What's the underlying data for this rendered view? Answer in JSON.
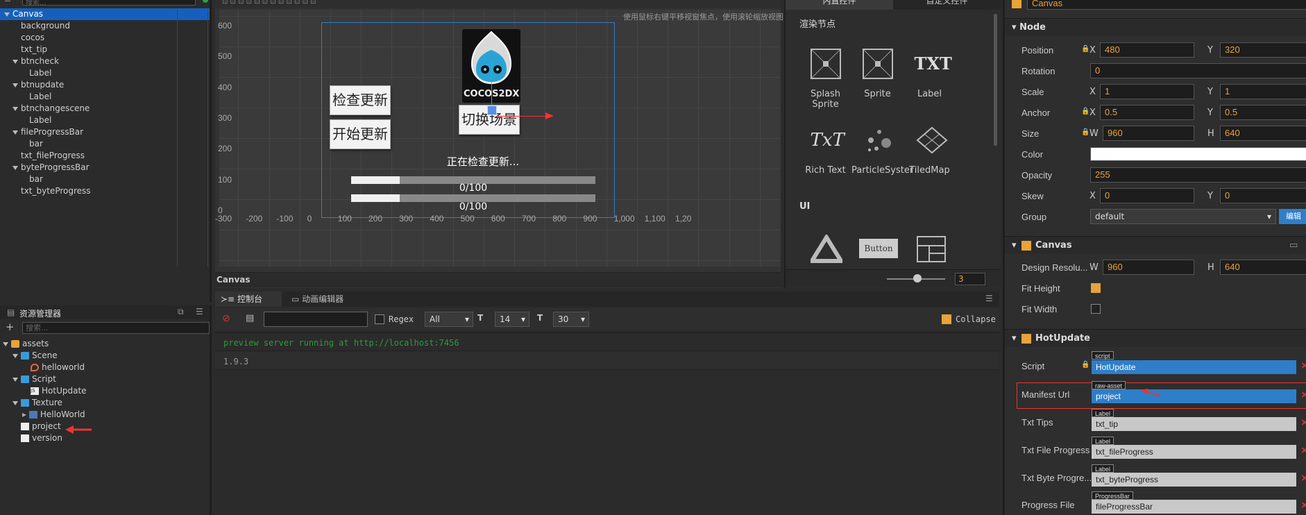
{
  "hierarchy": {
    "search_placeholder": "搜索...",
    "items": [
      {
        "label": "Canvas",
        "expanded": true
      },
      {
        "label": "background"
      },
      {
        "label": "cocos"
      },
      {
        "label": "txt_tip"
      },
      {
        "label": "btncheck",
        "expanded": true
      },
      {
        "label": "Label"
      },
      {
        "label": "btnupdate",
        "expanded": true
      },
      {
        "label": "Label"
      },
      {
        "label": "btnchangescene",
        "expanded": true
      },
      {
        "label": "Label"
      },
      {
        "label": "fileProgressBar",
        "expanded": true
      },
      {
        "label": "bar"
      },
      {
        "label": "txt_fileProgress"
      },
      {
        "label": "byteProgressBar",
        "expanded": true
      },
      {
        "label": "bar"
      },
      {
        "label": "txt_byteProgress"
      }
    ]
  },
  "scene": {
    "hint": "使用鼠标右键平移视窗焦点，使用滚轮缩放视图",
    "footer_label": "Canvas",
    "y_ticks": [
      "600",
      "500",
      "400",
      "300",
      "200",
      "100",
      "0"
    ],
    "x_ticks": [
      "-300",
      "-200",
      "-100",
      "0",
      "100",
      "200",
      "300",
      "400",
      "500",
      "600",
      "700",
      "800",
      "900",
      "1,000",
      "1,100",
      "1,20"
    ],
    "btn_check": "检查更新",
    "btn_update": "开始更新",
    "btn_change": "切换场景",
    "status": "正在检查更新...",
    "file_progress_text": "0/100",
    "byte_progress_text": "0/100",
    "file_progress": 0.2,
    "byte_progress": 0.2,
    "logo_text": "COCOS2DX"
  },
  "library": {
    "tab_builtin": "内置控件",
    "tab_custom": "自定义控件",
    "section_render": "渲染节点",
    "section_ui": "UI",
    "items": [
      "Splash Sprite",
      "Sprite",
      "Label",
      "Rich Text",
      "ParticleSyster",
      "TiledMap"
    ],
    "label_glyph": "TXT",
    "richtext_glyph": "TxT",
    "button_glyph": "Button",
    "zoom_value": "3"
  },
  "assets": {
    "title": "资源管理器",
    "search_placeholder": "搜索...",
    "items": [
      {
        "label": "assets"
      },
      {
        "label": "Scene"
      },
      {
        "label": "helloworld"
      },
      {
        "label": "Script"
      },
      {
        "label": "HotUpdate"
      },
      {
        "label": "Texture"
      },
      {
        "label": "HelloWorld"
      },
      {
        "label": "project"
      },
      {
        "label": "version"
      }
    ]
  },
  "console": {
    "tab_console": "控制台",
    "tab_anim": "动画编辑器",
    "regex_label": "Regex",
    "level_value": "All",
    "font_size": "14",
    "line_height": "30",
    "collapse_label": "Collapse",
    "lines": [
      "preview server running at http://localhost:7456",
      "1.9.3"
    ],
    "line_colors": [
      "#2e9a3a",
      "#999999"
    ]
  },
  "inspector": {
    "node_name": "Canvas",
    "node_section": "Node",
    "position": {
      "label": "Position",
      "x": "480",
      "y": "320"
    },
    "rotation": {
      "label": "Rotation",
      "value": "0"
    },
    "scale": {
      "label": "Scale",
      "x": "1",
      "y": "1"
    },
    "anchor": {
      "label": "Anchor",
      "x": "0.5",
      "y": "0.5"
    },
    "size": {
      "label": "Size",
      "w": "960",
      "h": "640"
    },
    "color": {
      "label": "Color",
      "value": "#ffffff"
    },
    "opacity": {
      "label": "Opacity",
      "value": "255"
    },
    "skew": {
      "label": "Skew",
      "x": "0",
      "y": "0"
    },
    "group": {
      "label": "Group",
      "value": "default",
      "edit": "编辑"
    },
    "canvas_section": "Canvas",
    "design_res": {
      "label": "Design Resolu...",
      "w": "960",
      "h": "640"
    },
    "fit_height": {
      "label": "Fit Height",
      "checked": true
    },
    "fit_width": {
      "label": "Fit Width",
      "checked": false
    },
    "hot_section": "HotUpdate",
    "script": {
      "label": "Script",
      "tag": "script",
      "value": "HotUpdate"
    },
    "manifest": {
      "label": "Manifest Url",
      "tag": "raw-asset",
      "value": "project"
    },
    "txt_tips": {
      "label": "Txt Tips",
      "tag": "Label",
      "value": "txt_tip"
    },
    "txt_file": {
      "label": "Txt File Progress",
      "tag": "Label",
      "value": "txt_fileProgress"
    },
    "txt_byte": {
      "label": "Txt Byte Progre...",
      "tag": "Label",
      "value": "txt_byteProgress"
    },
    "progress_file": {
      "label": "Progress File",
      "tag": "ProgressBar",
      "value": "fileProgressBar"
    },
    "axis_x": "X",
    "axis_y": "Y",
    "axis_w": "W",
    "axis_h": "H"
  },
  "colors": {
    "accent": "#e8a33a",
    "selection": "#1560bd",
    "folder": "#3a9ad9"
  }
}
